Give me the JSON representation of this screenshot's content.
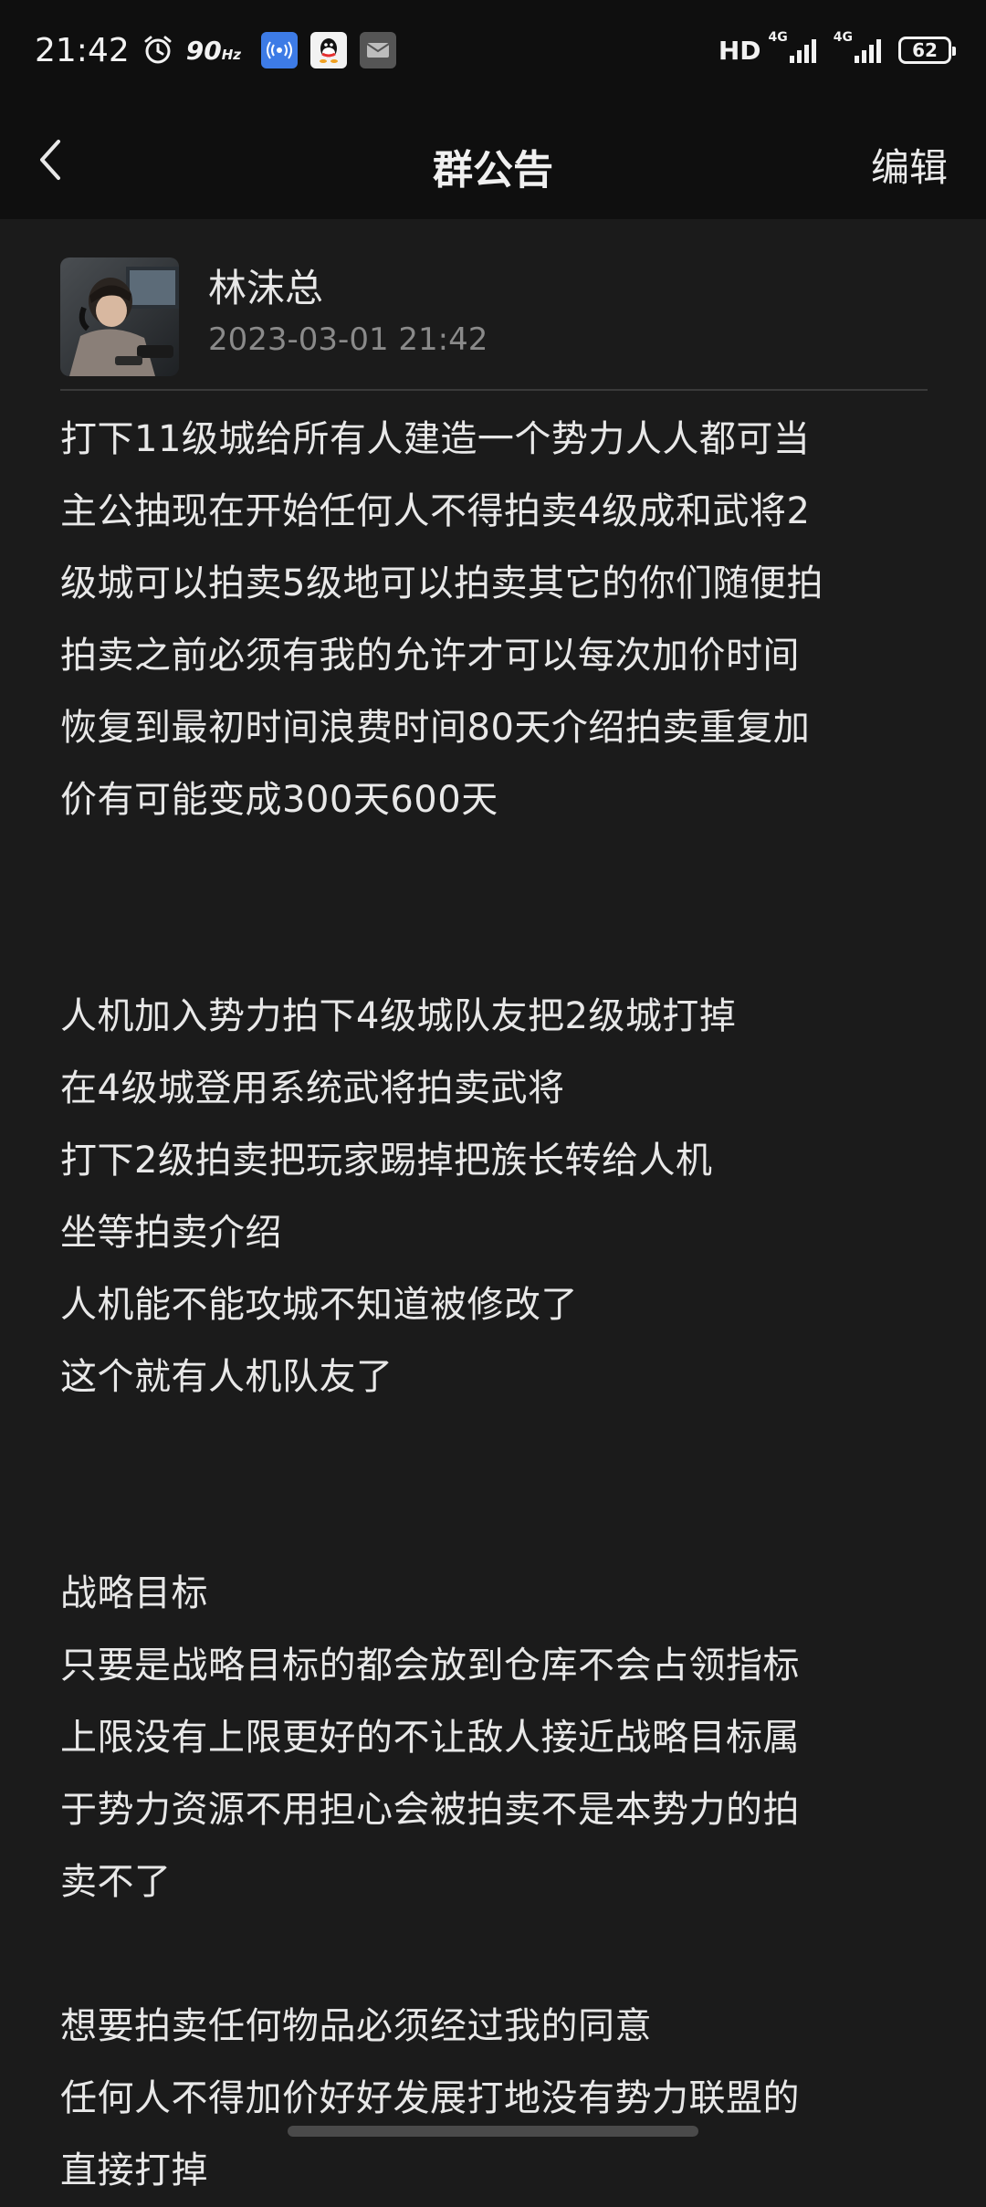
{
  "status_bar": {
    "time": "21:42",
    "refresh_rate": "90",
    "refresh_unit": "Hz",
    "hd_label": "HD",
    "network_1": "4G",
    "network_2": "4G",
    "battery": "62"
  },
  "header": {
    "title": "群公告",
    "edit_label": "编辑"
  },
  "author": {
    "name": "林沫总",
    "timestamp": "2023-03-01 21:42"
  },
  "notice_lines": [
    "打下11级城给所有人建造一个势力人人都可当",
    "主公抽现在开始任何人不得拍卖4级成和武将2",
    "级城可以拍卖5级地可以拍卖其它的你们随便拍",
    "拍卖之前必须有我的允许才可以每次加价时间",
    "恢复到最初时间浪费时间80天介绍拍卖重复加",
    "价有可能变成300天600天",
    "",
    "",
    "人机加入势力拍下4级城队友把2级城打掉",
    "在4级城登用系统武将拍卖武将",
    "打下2级拍卖把玩家踢掉把族长转给人机",
    "坐等拍卖介绍",
    "人机能不能攻城不知道被修改了",
    "这个就有人机队友了",
    "",
    "",
    "战略目标",
    "只要是战略目标的都会放到仓库不会占领指标",
    "上限没有上限更好的不让敌人接近战略目标属",
    "于势力资源不用担心会被拍卖不是本势力的拍",
    "卖不了",
    "",
    "想要拍卖任何物品必须经过我的同意",
    "任何人不得加价好好发展打地没有势力联盟的",
    "直接打掉"
  ]
}
